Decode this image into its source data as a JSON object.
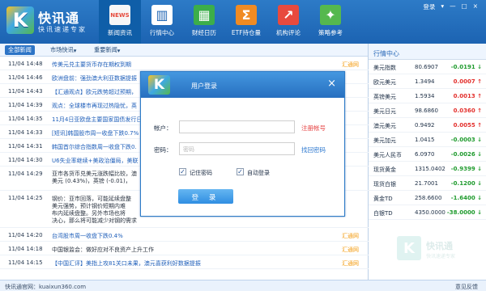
{
  "app": {
    "name": "快讯通",
    "slogan": "快讯速递专家"
  },
  "nav": [
    {
      "label": "新闻资讯",
      "icon": "NEWS"
    },
    {
      "label": "行情中心",
      "icon": "▥"
    },
    {
      "label": "财经日历",
      "icon": "▦"
    },
    {
      "label": "ETF持仓量",
      "icon": "Σ"
    },
    {
      "label": "机构评论",
      "icon": "↗"
    },
    {
      "label": "策略参考",
      "icon": "✦"
    }
  ],
  "top_right": {
    "login": "登录",
    "dropdown": "▾",
    "minimize": "—",
    "maximize": "□",
    "close": "×"
  },
  "news_tabs": [
    "全部新闻",
    "市场快讯",
    "重要新闻"
  ],
  "tab_arrows": [
    "▾",
    "▾"
  ],
  "news": [
    {
      "time": "11/04 14:48",
      "title": "传美元兑主要货币存在期权到期",
      "source": "汇通网",
      "plain": false
    },
    {
      "time": "11/04 14:46",
      "title": "欧洲盘前：强劲澳大利亚数据提振",
      "source": "",
      "plain": false
    },
    {
      "time": "11/04 14:43",
      "title": "【汇通观点】欧元跌势超过预期，",
      "source": "",
      "plain": false
    },
    {
      "time": "11/04 14:39",
      "title": "观点：全球楼市再现过热隐忧，英",
      "source": "",
      "plain": false
    },
    {
      "time": "11/04 14:35",
      "title": "11月4日亚欧盘主要国家国债发行日",
      "source": "",
      "plain": false
    },
    {
      "time": "11/04 14:33",
      "title": "[短讯]韩国股市周一收盘下跌0.7%",
      "source": "",
      "plain": false
    },
    {
      "time": "11/04 14:31",
      "title": "韩国首尔综合指数周一收盘下跌0.",
      "source": "",
      "plain": false
    },
    {
      "time": "11/04 14:30",
      "title": "U6失业率继续+美政治僵局，美联",
      "source": "",
      "plain": false
    }
  ],
  "news_block_1": {
    "time": "11/04 14:29",
    "lines": [
      "亚市各货币兑美元涨跌幅比较，澳",
      "美元 (0.43%)，英镑 (-0.01)，"
    ]
  },
  "news_block_2": {
    "time": "11/04 14:25",
    "lines": [
      "钢价：亚市回落，可能延续盘整",
      "美元强势，预计钢价短期内难",
      "布内延续盘整。另外市场也将",
      "决心，那么将可能减少对钢的需求"
    ]
  },
  "news_bottom": [
    {
      "time": "11/04 14:20",
      "title": "台湾股市周一收盘下跌0.4%",
      "source": "汇通网",
      "plain": false
    },
    {
      "time": "11/04 14:18",
      "title": "中国银监会：做好应对不良资产上升工作",
      "source": "汇通网",
      "plain": true
    },
    {
      "time": "11/04 14:15",
      "title": "【中国汇评】美指上攻81关口未果，澳元喜获利好数据提振",
      "source": "汇通网",
      "plain": false
    }
  ],
  "statusbar": {
    "left": "快讯通官网：kuaixun360.com",
    "right": "意见反馈"
  },
  "market": {
    "title": "行情中心",
    "rows": [
      {
        "name": "美元指数",
        "price": "80.6907",
        "change": "-0.0191",
        "dir": "down",
        "arrow": "↓"
      },
      {
        "name": "欧元美元",
        "price": "1.3494",
        "change": "0.0007",
        "dir": "up",
        "arrow": "↑"
      },
      {
        "name": "英镑美元",
        "price": "1.5934",
        "change": "0.0013",
        "dir": "up",
        "arrow": "↑"
      },
      {
        "name": "美元日元",
        "price": "98.6860",
        "change": "0.0360",
        "dir": "up",
        "arrow": "↑"
      },
      {
        "name": "澳元美元",
        "price": "0.9492",
        "change": "0.0055",
        "dir": "up",
        "arrow": "↑"
      },
      {
        "name": "美元加元",
        "price": "1.0415",
        "change": "-0.0003",
        "dir": "down",
        "arrow": "↓"
      },
      {
        "name": "美元人民币",
        "price": "6.0970",
        "change": "-0.0026",
        "dir": "down",
        "arrow": "↓"
      },
      {
        "name": "现货黄金",
        "price": "1315.0402",
        "change": "-0.9399",
        "dir": "down",
        "arrow": "↓"
      },
      {
        "name": "现货白银",
        "price": "21.7001",
        "change": "-0.1200",
        "dir": "down",
        "arrow": "↓"
      },
      {
        "name": "黄金TD",
        "price": "258.6600",
        "change": "-1.6400",
        "dir": "down",
        "arrow": "↓"
      },
      {
        "name": "白银TD",
        "price": "4350.0000",
        "change": "-38.0000",
        "dir": "down",
        "arrow": "↓"
      }
    ]
  },
  "modal": {
    "title": "用户登录",
    "account_label": "帐户：",
    "password_label": "密码：",
    "password_placeholder": "密码",
    "register": "注册帐号",
    "find_password": "找回密码",
    "remember_password": "记住密码",
    "auto_login": "自动登录",
    "login_button": "登 录",
    "close": "×",
    "check_mark": "✓"
  },
  "watermark": {
    "logo_letter": "K",
    "text": "快讯通",
    "sub": "快讯速递专家"
  },
  "colors": {
    "header": "#1c63b2",
    "accent": "#2c74c6",
    "up": "#e3302d",
    "down": "#1f9b2e",
    "source": "#f39c12"
  }
}
